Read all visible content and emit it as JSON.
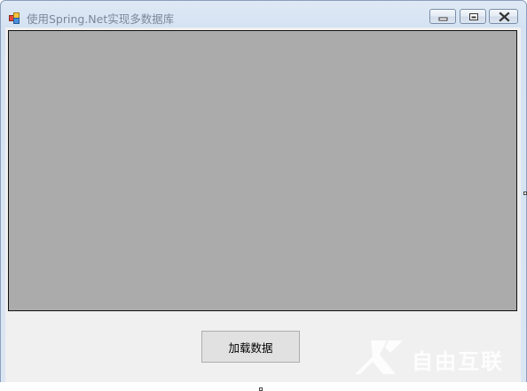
{
  "window": {
    "title": "使用Spring.Net实现多数据库",
    "icon": "app-form-icon",
    "controls": {
      "minimize_icon": "minimize-icon",
      "maximize_icon": "maximize-icon",
      "close_icon": "close-icon"
    }
  },
  "main": {
    "grid_background": "#ababab",
    "load_button_label": "加载数据"
  },
  "watermark": {
    "text": "自由互联",
    "icon": "x-logo-icon"
  },
  "colors": {
    "client_bg": "#f0f0f0",
    "title_text": "#7b8797",
    "frame": "#dbe6f3"
  }
}
